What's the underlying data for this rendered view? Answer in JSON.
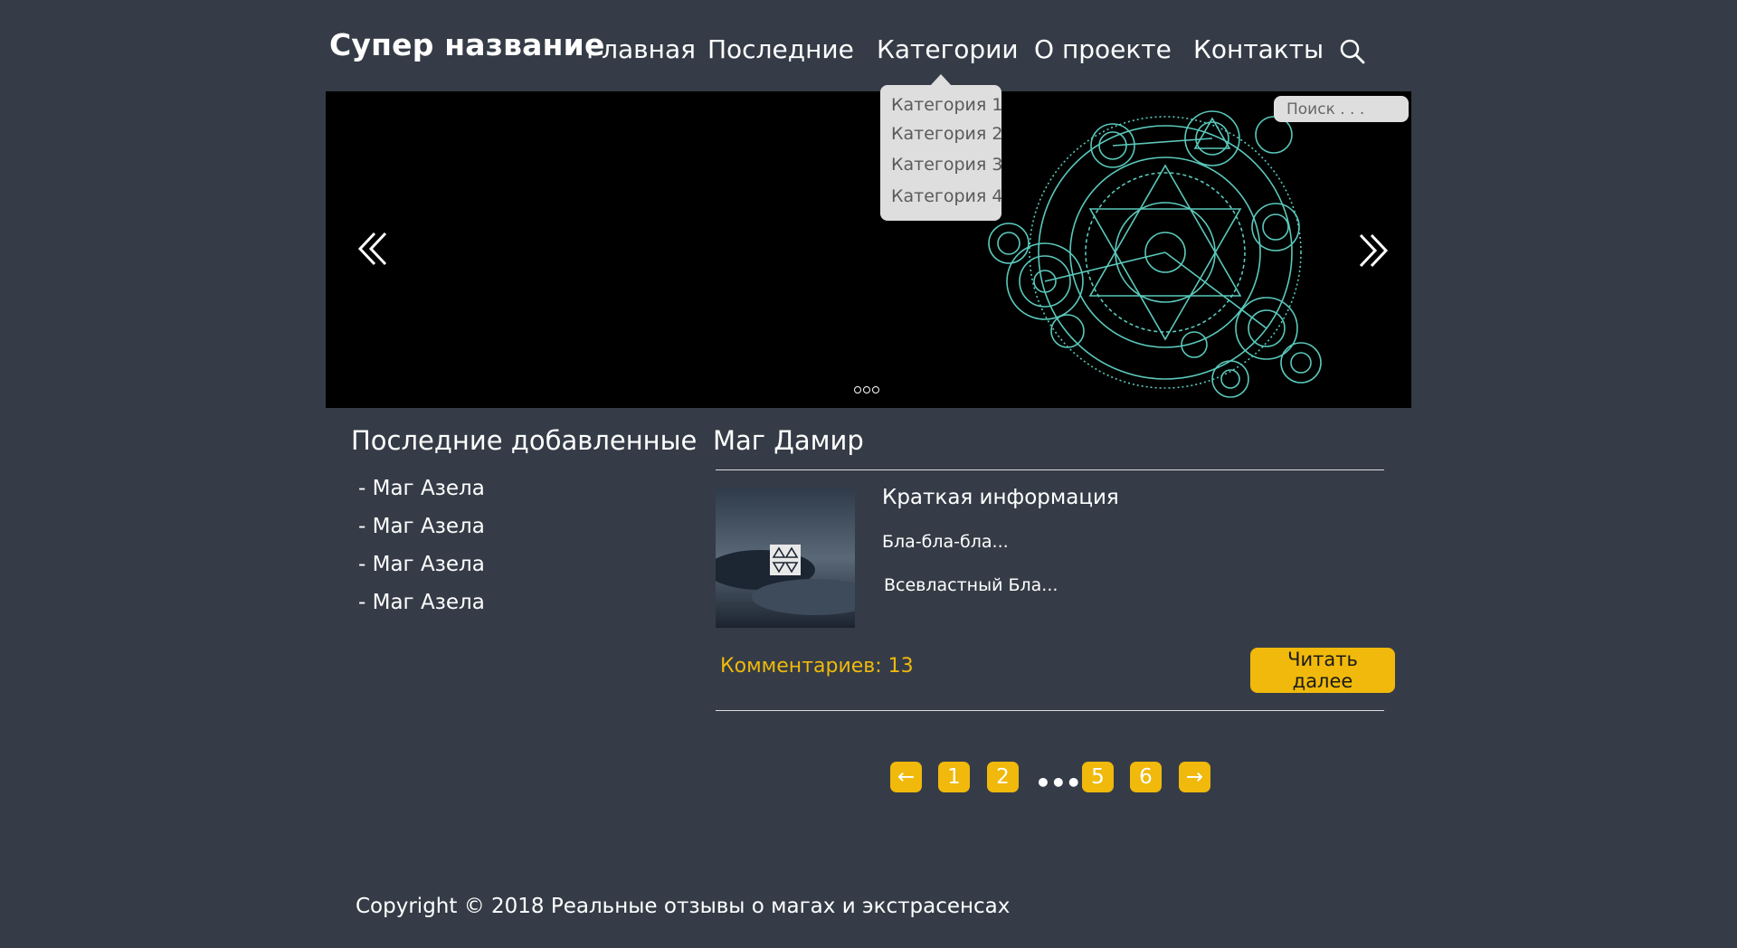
{
  "header": {
    "brand": "Супер название",
    "nav": [
      "Главная",
      "Последние",
      "Категории",
      "О проекте",
      "Контакты"
    ]
  },
  "dropdown": {
    "items": [
      "Категория 1",
      "Категория 2",
      "Категория 3",
      "Категория 4"
    ]
  },
  "slider": {
    "search_placeholder": "Поиск . . .",
    "icons": {
      "prev": "double-chevron-left-icon",
      "next": "double-chevron-right-icon"
    }
  },
  "sidebar": {
    "title": "Последние добавленные",
    "items": [
      "- Маг Азела",
      "- Маг Азела",
      "- Маг Азела",
      "- Маг Азела"
    ]
  },
  "article": {
    "title": "Маг Дамир",
    "info_title": "Краткая информация",
    "line1": "Бла-бла-бла...",
    "line2": "Всевластный Бла...",
    "comments": "Комментариев: 13",
    "read_more": "Читать далее"
  },
  "pagination": {
    "prev": "←",
    "pages": [
      "1",
      "2",
      "5",
      "6"
    ],
    "ellipsis": "•••",
    "next": "→"
  },
  "footer": {
    "copyright": "Copyright © 2018 Реальные отзывы о магах и экстрасенсах"
  },
  "colors": {
    "background": "#353c47",
    "accent": "#f0b90b",
    "dropdown_bg": "#dedede"
  }
}
